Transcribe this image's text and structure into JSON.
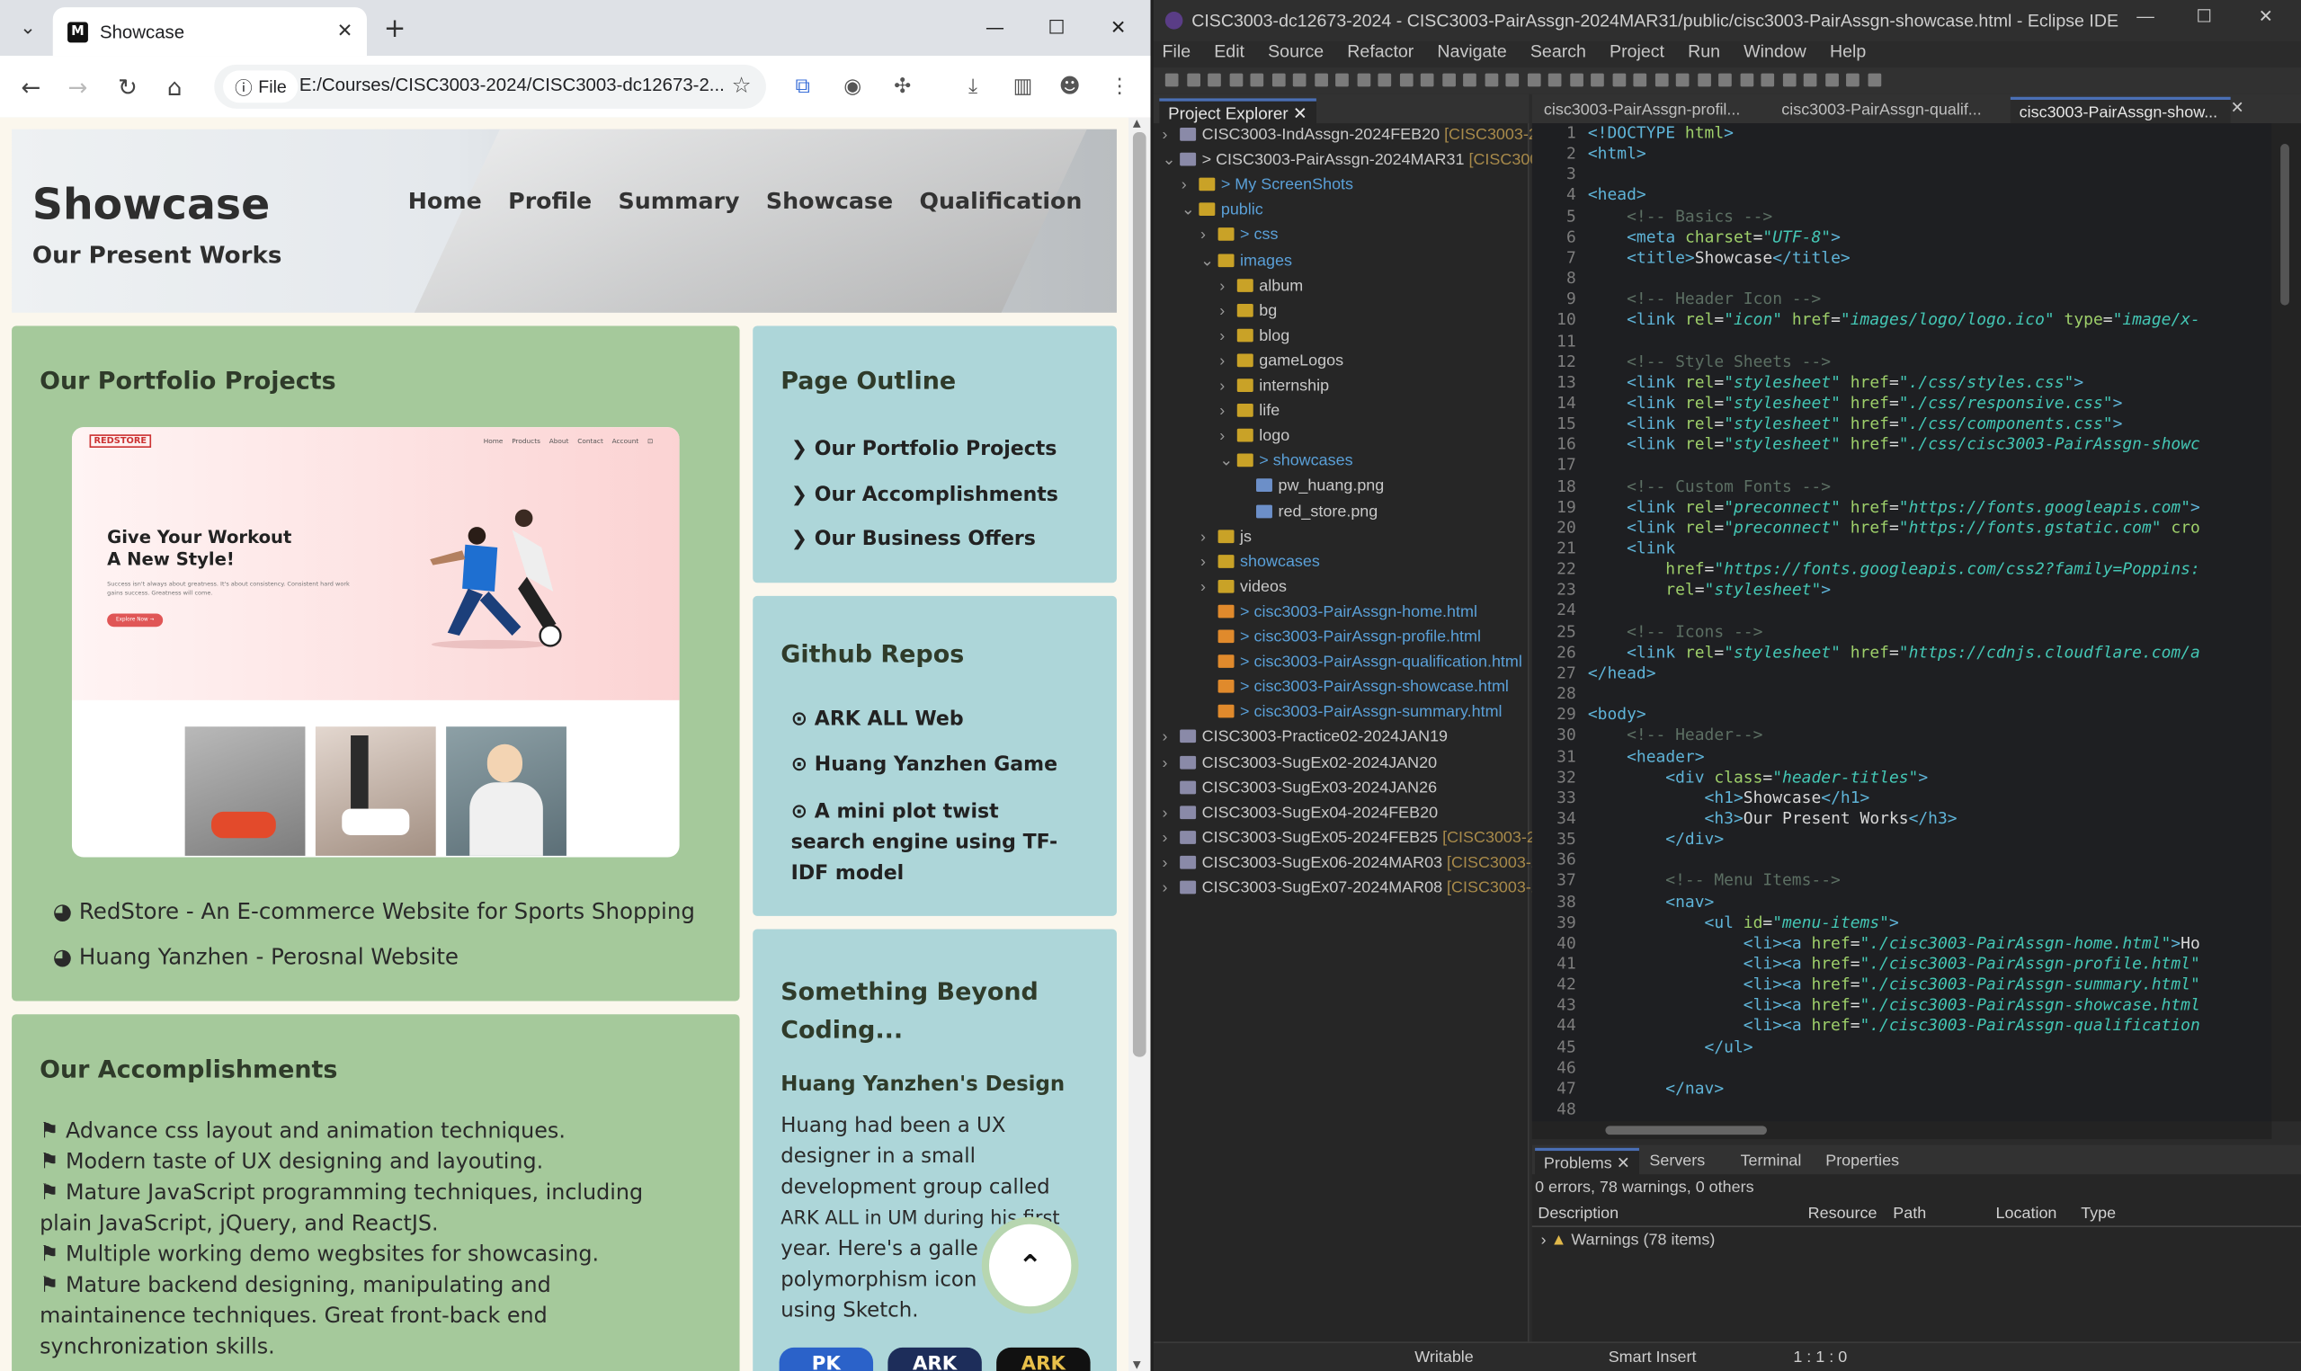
{
  "browser": {
    "tab_title": "Showcase",
    "url_scheme": "File",
    "url": "E:/Courses/CISC3003-2024/CISC3003-dc12673-2...",
    "page": {
      "hero": {
        "title": "Showcase",
        "subtitle": "Our Present Works",
        "menu": [
          "Home",
          "Profile",
          "Summary",
          "Showcase",
          "Qualification"
        ]
      },
      "portfolio": {
        "title": "Our Portfolio Projects",
        "mock": {
          "logo": "REDSTORE",
          "nav": [
            "Home",
            "Products",
            "About",
            "Contact",
            "Account"
          ],
          "headline1": "Give Your Workout",
          "headline2": "A New Style!",
          "body": "Success isn't always about greatness. It's about consistency. Consistent hard work gains success. Greatness will come.",
          "button": "Explore Now →"
        },
        "links": [
          "RedStore - An E-commerce Website for Sports Shopping",
          "Huang Yanzhen - Perosnal Website"
        ]
      },
      "outline": {
        "title": "Page Outline",
        "items": [
          "Our Portfolio Projects",
          "Our Accomplishments",
          "Our Business Offers"
        ]
      },
      "github": {
        "title": "Github Repos",
        "items": [
          "ARK ALL Web",
          "Huang Yanzhen Game",
          "A mini plot twist",
          "search engine using TF-",
          "IDF model"
        ]
      },
      "beyond": {
        "title_line1": "Something Beyond",
        "title_line2": "Coding...",
        "subtitle": "Huang Yanzhen's Design",
        "lines": [
          "Huang had been a UX",
          "designer in a small",
          "development group called",
          "ARK ALL in UM during his first",
          "year. Here's a galle",
          "polymorphism icon",
          "using Sketch."
        ]
      },
      "accomplishments": {
        "title": "Our Accomplishments",
        "lines": [
          "Advance css layout and animation techniques.",
          "Modern taste of UX designing and layouting.",
          "Mature JavaScript programming techniques, including",
          "plain JavaScript, jQuery, and ReactJS.",
          "Multiple working demo wegbsites for showcasing.",
          "Mature backend designing, manipulating and",
          "maintainence techniques. Great front-back end",
          "synchronization skills."
        ]
      },
      "badges": [
        "PK",
        "ARK",
        "ARK"
      ]
    }
  },
  "eclipse": {
    "title": "CISC3003-dc12673-2024 - CISC3003-PairAssgn-2024MAR31/public/cisc3003-PairAssgn-showcase.html - Eclipse IDE",
    "menu": [
      "File",
      "Edit",
      "Source",
      "Refactor",
      "Navigate",
      "Search",
      "Project",
      "Run",
      "Window",
      "Help"
    ],
    "explorer_title": "Project Explorer",
    "tree": [
      {
        "indent": 0,
        "label": "CISC3003-IndAssgn-2024FEB20",
        "deco": " [CISC3003-20",
        "type": "proj",
        "arrow": "›"
      },
      {
        "indent": 0,
        "label": "> CISC3003-PairAssgn-2024MAR31",
        "deco": " [CISC3003",
        "type": "proj",
        "arrow": "⌄"
      },
      {
        "indent": 1,
        "label": "> My ScreenShots",
        "deco": "",
        "type": "fold",
        "arrow": "›"
      },
      {
        "indent": 1,
        "label": "public",
        "deco": "",
        "type": "fold",
        "arrow": "⌄"
      },
      {
        "indent": 2,
        "label": "> css",
        "deco": "",
        "type": "fold",
        "arrow": "›"
      },
      {
        "indent": 2,
        "label": "images",
        "deco": "",
        "type": "fold",
        "arrow": "⌄"
      },
      {
        "indent": 3,
        "label": "album",
        "deco": "",
        "type": "fold",
        "arrow": "›"
      },
      {
        "indent": 3,
        "label": "bg",
        "deco": "",
        "type": "fold",
        "arrow": "›"
      },
      {
        "indent": 3,
        "label": "blog",
        "deco": "",
        "type": "fold",
        "arrow": "›"
      },
      {
        "indent": 3,
        "label": "gameLogos",
        "deco": "",
        "type": "fold",
        "arrow": "›"
      },
      {
        "indent": 3,
        "label": "internship",
        "deco": "",
        "type": "fold",
        "arrow": "›"
      },
      {
        "indent": 3,
        "label": "life",
        "deco": "",
        "type": "fold",
        "arrow": "›"
      },
      {
        "indent": 3,
        "label": "logo",
        "deco": "",
        "type": "fold",
        "arrow": "›"
      },
      {
        "indent": 3,
        "label": "> showcases",
        "deco": "",
        "type": "fold",
        "arrow": "⌄"
      },
      {
        "indent": 4,
        "label": "pw_huang.png",
        "deco": "",
        "type": "png",
        "arrow": ""
      },
      {
        "indent": 4,
        "label": "red_store.png",
        "deco": "",
        "type": "png",
        "arrow": ""
      },
      {
        "indent": 2,
        "label": "js",
        "deco": "",
        "type": "fold",
        "arrow": "›"
      },
      {
        "indent": 2,
        "label": "showcases",
        "deco": "",
        "type": "fold",
        "arrow": "›"
      },
      {
        "indent": 2,
        "label": "videos",
        "deco": "",
        "type": "fold",
        "arrow": "›"
      },
      {
        "indent": 2,
        "label": "> cisc3003-PairAssgn-home.html",
        "deco": "",
        "type": "htm",
        "arrow": ""
      },
      {
        "indent": 2,
        "label": "> cisc3003-PairAssgn-profile.html",
        "deco": "",
        "type": "htm",
        "arrow": ""
      },
      {
        "indent": 2,
        "label": "> cisc3003-PairAssgn-qualification.html",
        "deco": "",
        "type": "htm",
        "arrow": ""
      },
      {
        "indent": 2,
        "label": "> cisc3003-PairAssgn-showcase.html",
        "deco": "",
        "type": "htm",
        "arrow": ""
      },
      {
        "indent": 2,
        "label": "> cisc3003-PairAssgn-summary.html",
        "deco": "",
        "type": "htm",
        "arrow": ""
      },
      {
        "indent": 0,
        "label": "CISC3003-Practice02-2024JAN19",
        "deco": "",
        "type": "proj",
        "arrow": "›"
      },
      {
        "indent": 0,
        "label": "CISC3003-SugEx02-2024JAN20",
        "deco": "",
        "type": "proj",
        "arrow": "›"
      },
      {
        "indent": 0,
        "label": "CISC3003-SugEx03-2024JAN26",
        "deco": "",
        "type": "proj",
        "arrow": ""
      },
      {
        "indent": 0,
        "label": "CISC3003-SugEx04-2024FEB20",
        "deco": "",
        "type": "proj",
        "arrow": "›"
      },
      {
        "indent": 0,
        "label": "CISC3003-SugEx05-2024FEB25",
        "deco": " [CISC3003-202",
        "type": "proj",
        "arrow": "›"
      },
      {
        "indent": 0,
        "label": "CISC3003-SugEx06-2024MAR03",
        "deco": " [CISC3003-20",
        "type": "proj",
        "arrow": "›"
      },
      {
        "indent": 0,
        "label": "CISC3003-SugEx07-2024MAR08",
        "deco": " [CISC3003-20",
        "type": "proj",
        "arrow": "›"
      }
    ],
    "editor_tabs": [
      "cisc3003-PairAssgn-profil...",
      "cisc3003-PairAssgn-qualif...",
      "cisc3003-PairAssgn-show..."
    ],
    "code": [
      [
        [
          "tg",
          "<!DOCTYPE "
        ],
        [
          "at",
          "html"
        ],
        [
          "tg",
          ">"
        ]
      ],
      [
        [
          "tg",
          "<html>"
        ]
      ],
      [],
      [
        [
          "tg",
          "<head>"
        ]
      ],
      [
        [
          "cm",
          "    <!-- Basics -->"
        ]
      ],
      [
        [
          "tx",
          "    "
        ],
        [
          "tg",
          "<meta "
        ],
        [
          "at",
          "charset"
        ],
        [
          "tx",
          "="
        ],
        [
          "vl",
          "\"UTF-8\""
        ],
        [
          "tg",
          ">"
        ]
      ],
      [
        [
          "tx",
          "    "
        ],
        [
          "tg",
          "<title>"
        ],
        [
          "tx",
          "Showcase"
        ],
        [
          "tg",
          "</title>"
        ]
      ],
      [],
      [
        [
          "cm",
          "    <!-- Header Icon -->"
        ]
      ],
      [
        [
          "tx",
          "    "
        ],
        [
          "tg",
          "<link "
        ],
        [
          "at",
          "rel"
        ],
        [
          "tx",
          "="
        ],
        [
          "vl",
          "\"icon\" "
        ],
        [
          "at",
          "href"
        ],
        [
          "tx",
          "="
        ],
        [
          "vl",
          "\"images/logo/logo.ico\" "
        ],
        [
          "at",
          "type"
        ],
        [
          "tx",
          "="
        ],
        [
          "vl",
          "\"image/x-"
        ]
      ],
      [],
      [
        [
          "cm",
          "    <!-- Style Sheets -->"
        ]
      ],
      [
        [
          "tx",
          "    "
        ],
        [
          "tg",
          "<link "
        ],
        [
          "at",
          "rel"
        ],
        [
          "tx",
          "="
        ],
        [
          "vl",
          "\"stylesheet\" "
        ],
        [
          "at",
          "href"
        ],
        [
          "tx",
          "="
        ],
        [
          "vl",
          "\"./css/styles.css\""
        ],
        [
          "tg",
          ">"
        ]
      ],
      [
        [
          "tx",
          "    "
        ],
        [
          "tg",
          "<link "
        ],
        [
          "at",
          "rel"
        ],
        [
          "tx",
          "="
        ],
        [
          "vl",
          "\"stylesheet\" "
        ],
        [
          "at",
          "href"
        ],
        [
          "tx",
          "="
        ],
        [
          "vl",
          "\"./css/responsive.css\""
        ],
        [
          "tg",
          ">"
        ]
      ],
      [
        [
          "tx",
          "    "
        ],
        [
          "tg",
          "<link "
        ],
        [
          "at",
          "rel"
        ],
        [
          "tx",
          "="
        ],
        [
          "vl",
          "\"stylesheet\" "
        ],
        [
          "at",
          "href"
        ],
        [
          "tx",
          "="
        ],
        [
          "vl",
          "\"./css/components.css\""
        ],
        [
          "tg",
          ">"
        ]
      ],
      [
        [
          "tx",
          "    "
        ],
        [
          "tg",
          "<link "
        ],
        [
          "at",
          "rel"
        ],
        [
          "tx",
          "="
        ],
        [
          "vl",
          "\"stylesheet\" "
        ],
        [
          "at",
          "href"
        ],
        [
          "tx",
          "="
        ],
        [
          "vl",
          "\"./css/cisc3003-PairAssgn-showc"
        ]
      ],
      [],
      [
        [
          "cm",
          "    <!-- Custom Fonts -->"
        ]
      ],
      [
        [
          "tx",
          "    "
        ],
        [
          "tg",
          "<link "
        ],
        [
          "at",
          "rel"
        ],
        [
          "tx",
          "="
        ],
        [
          "vl",
          "\"preconnect\" "
        ],
        [
          "at",
          "href"
        ],
        [
          "tx",
          "="
        ],
        [
          "vl",
          "\"https://fonts.googleapis.com\""
        ],
        [
          "tg",
          ">"
        ]
      ],
      [
        [
          "tx",
          "    "
        ],
        [
          "tg",
          "<link "
        ],
        [
          "at",
          "rel"
        ],
        [
          "tx",
          "="
        ],
        [
          "vl",
          "\"preconnect\" "
        ],
        [
          "at",
          "href"
        ],
        [
          "tx",
          "="
        ],
        [
          "vl",
          "\"https://fonts.gstatic.com\" "
        ],
        [
          "at",
          "cro"
        ]
      ],
      [
        [
          "tx",
          "    "
        ],
        [
          "tg",
          "<link"
        ]
      ],
      [
        [
          "tx",
          "        "
        ],
        [
          "at",
          "href"
        ],
        [
          "tx",
          "="
        ],
        [
          "vl",
          "\"https://fonts.googleapis.com/css2?family=Poppins:"
        ]
      ],
      [
        [
          "tx",
          "        "
        ],
        [
          "at",
          "rel"
        ],
        [
          "tx",
          "="
        ],
        [
          "vl",
          "\"stylesheet\""
        ],
        [
          "tg",
          ">"
        ]
      ],
      [],
      [
        [
          "cm",
          "    <!-- Icons -->"
        ]
      ],
      [
        [
          "tx",
          "    "
        ],
        [
          "tg",
          "<link "
        ],
        [
          "at",
          "rel"
        ],
        [
          "tx",
          "="
        ],
        [
          "vl",
          "\"stylesheet\" "
        ],
        [
          "at",
          "href"
        ],
        [
          "tx",
          "="
        ],
        [
          "vl",
          "\"https://cdnjs.cloudflare.com/a"
        ]
      ],
      [
        [
          "tg",
          "</head>"
        ]
      ],
      [],
      [
        [
          "tg",
          "<body>"
        ]
      ],
      [
        [
          "cm",
          "    <!-- Header-->"
        ]
      ],
      [
        [
          "tx",
          "    "
        ],
        [
          "tg",
          "<header>"
        ]
      ],
      [
        [
          "tx",
          "        "
        ],
        [
          "tg",
          "<div "
        ],
        [
          "at",
          "class"
        ],
        [
          "tx",
          "="
        ],
        [
          "vl",
          "\"header-titles\""
        ],
        [
          "tg",
          ">"
        ]
      ],
      [
        [
          "tx",
          "            "
        ],
        [
          "tg",
          "<h1>"
        ],
        [
          "tx",
          "Showcase"
        ],
        [
          "tg",
          "</h1>"
        ]
      ],
      [
        [
          "tx",
          "            "
        ],
        [
          "tg",
          "<h3>"
        ],
        [
          "tx",
          "Our Present Works"
        ],
        [
          "tg",
          "</h3>"
        ]
      ],
      [
        [
          "tx",
          "        "
        ],
        [
          "tg",
          "</div>"
        ]
      ],
      [],
      [
        [
          "cm",
          "        <!-- Menu Items-->"
        ]
      ],
      [
        [
          "tx",
          "        "
        ],
        [
          "tg",
          "<nav>"
        ]
      ],
      [
        [
          "tx",
          "            "
        ],
        [
          "tg",
          "<ul "
        ],
        [
          "at",
          "id"
        ],
        [
          "tx",
          "="
        ],
        [
          "vl",
          "\"menu-items\""
        ],
        [
          "tg",
          ">"
        ]
      ],
      [
        [
          "tx",
          "                "
        ],
        [
          "tg",
          "<li><a "
        ],
        [
          "at",
          "href"
        ],
        [
          "tx",
          "="
        ],
        [
          "vl",
          "\"./cisc3003-PairAssgn-home.html\""
        ],
        [
          "tg",
          ">"
        ],
        [
          "tx",
          "Ho"
        ]
      ],
      [
        [
          "tx",
          "                "
        ],
        [
          "tg",
          "<li><a "
        ],
        [
          "at",
          "href"
        ],
        [
          "tx",
          "="
        ],
        [
          "vl",
          "\"./cisc3003-PairAssgn-profile.html\""
        ]
      ],
      [
        [
          "tx",
          "                "
        ],
        [
          "tg",
          "<li><a "
        ],
        [
          "at",
          "href"
        ],
        [
          "tx",
          "="
        ],
        [
          "vl",
          "\"./cisc3003-PairAssgn-summary.html\""
        ]
      ],
      [
        [
          "tx",
          "                "
        ],
        [
          "tg",
          "<li><a "
        ],
        [
          "at",
          "href"
        ],
        [
          "tx",
          "="
        ],
        [
          "vl",
          "\"./cisc3003-PairAssgn-showcase.html"
        ]
      ],
      [
        [
          "tx",
          "                "
        ],
        [
          "tg",
          "<li><a "
        ],
        [
          "at",
          "href"
        ],
        [
          "tx",
          "="
        ],
        [
          "vl",
          "\"./cisc3003-PairAssgn-qualification"
        ]
      ],
      [
        [
          "tx",
          "            "
        ],
        [
          "tg",
          "</ul>"
        ]
      ],
      [],
      [
        [
          "tx",
          "        "
        ],
        [
          "tg",
          "</nav>"
        ]
      ],
      []
    ],
    "problems": {
      "tabs": [
        "Problems",
        "Servers",
        "Terminal",
        "Properties"
      ],
      "summary": "0 errors, 78 warnings, 0 others",
      "columns": [
        "Description",
        "Resource",
        "Path",
        "Location",
        "Type"
      ],
      "row": "Warnings (78 items)"
    },
    "status": {
      "mode": "Writable",
      "insert": "Smart Insert",
      "pos": "1 : 1 : 0"
    }
  }
}
